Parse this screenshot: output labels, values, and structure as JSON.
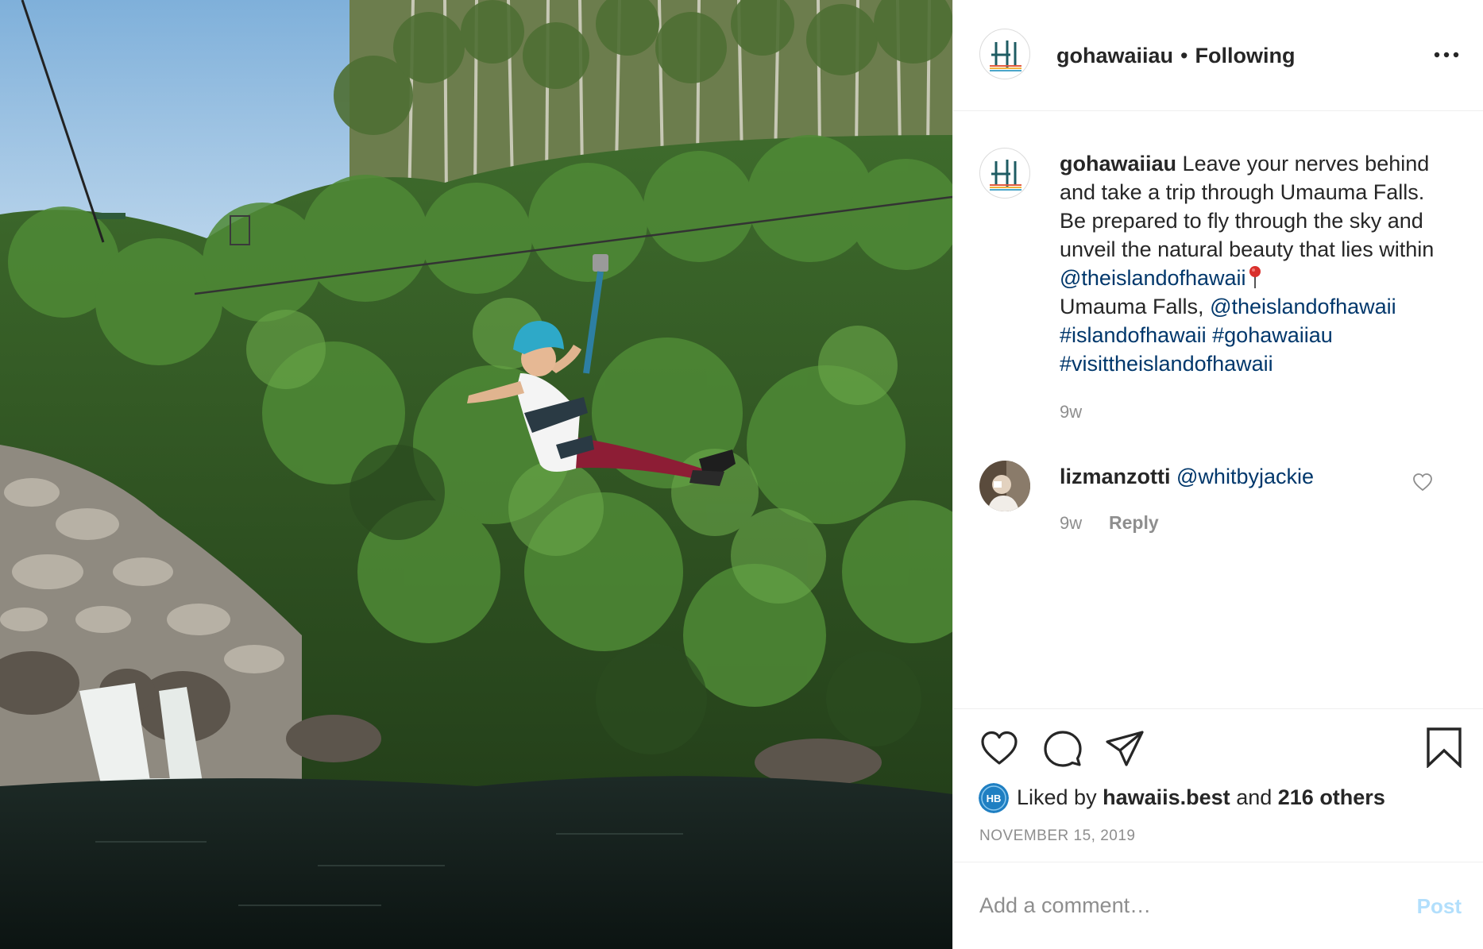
{
  "post": {
    "photo_alt": "",
    "icon": "zipline-photo"
  },
  "header": {
    "username": "gohawaiiau",
    "separator": "•",
    "follow_status": "Following",
    "more_icon": "more-horizontal-icon"
  },
  "caption": {
    "username": "gohawaiiau",
    "text_1": "Leave your nerves behind and take a trip through Umauma Falls. Be prepared to fly through the sky and unveil the natural beauty that lies within",
    "mention_1": "@theislandofhawaii",
    "pin_icon": "round-pushpin-icon",
    "text_2": "Umauma Falls,",
    "mention_2": "@theislandofhawaii",
    "hashtag_1": "#islandofhawaii",
    "hashtag_2": "#gohawaiiau",
    "hashtag_3": "#visittheislandofhawaii",
    "time": "9w"
  },
  "comments": [
    {
      "username": "lizmanzotti",
      "mention": "@whitbyjackie",
      "time": "9w",
      "reply_label": "Reply",
      "heart_icon": "heart-outline-icon"
    }
  ],
  "actions": {
    "like_icon": "heart-icon",
    "comment_icon": "comment-bubble-icon",
    "share_icon": "paper-plane-icon",
    "save_icon": "bookmark-icon"
  },
  "likes": {
    "prefix": "Liked by",
    "liker": "hawaiis.best",
    "conjunction": "and",
    "others": "216 others",
    "liker_avatar_text": "HB"
  },
  "date": "NOVEMBER 15, 2019",
  "add_comment": {
    "placeholder": "Add a comment…",
    "post_label": "Post"
  },
  "colors": {
    "link": "#00376b",
    "muted": "#8e8e8e",
    "post_disabled": "#b2dffc",
    "text": "#262626"
  }
}
